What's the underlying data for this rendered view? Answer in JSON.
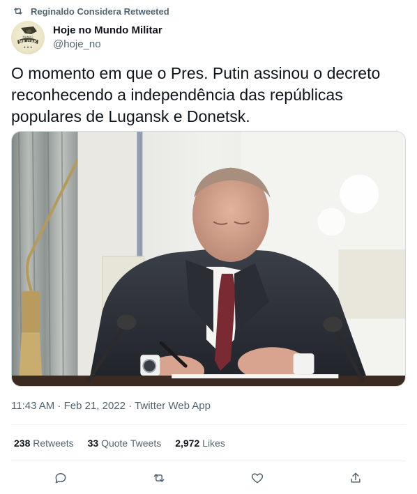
{
  "retweet": {
    "label": "Reginaldo Considera Retweeted",
    "icon": "retweet-icon"
  },
  "author": {
    "display_name": "Hoje no Mundo Militar",
    "handle": "@hoje_no",
    "avatar_logo_text": "MUNDO MILITAR"
  },
  "tweet": {
    "text": "O momento em que o Pres. Putin assinou o decreto reconhecendo a independência das repúblicas populares de Lugansk e Donetsk.",
    "timestamp": "11:43 AM · Feb 21, 2022 · Twitter Web App"
  },
  "stats": {
    "retweets_count": "238",
    "retweets_label": "Retweets",
    "quote_count": "33",
    "quote_label": "Quote Tweets",
    "likes_count": "2,972",
    "likes_label": "Likes"
  },
  "actions": {
    "reply_icon": "reply-icon",
    "retweet_icon": "retweet-icon",
    "like_icon": "heart-icon",
    "share_icon": "share-icon"
  },
  "colors": {
    "text_primary": "#0f1419",
    "text_secondary": "#536471",
    "divider": "#eff3f4"
  }
}
